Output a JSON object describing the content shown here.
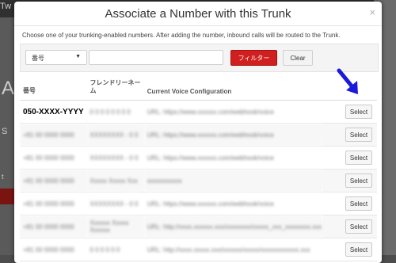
{
  "background": {
    "fragments": [
      "Tw",
      "A",
      "S",
      "t"
    ]
  },
  "modal": {
    "title": "Associate a Number with this Trunk",
    "close_glyph": "×",
    "intro": "Choose one of your trunking-enabled numbers. After adding the number, inbound calls will be routed to the Trunk."
  },
  "filter": {
    "field_label": "番号",
    "search_value": "",
    "filter_button": "フィルター",
    "clear_button": "Clear"
  },
  "table": {
    "headers": {
      "number": "番号",
      "friendly_name": "フレンドリーネーム",
      "voice_config": "Current Voice Configuration"
    },
    "select_label": "Select",
    "rows": [
      {
        "number": "050-XXXX-YYYY",
        "name": "0 0 0 0 0 0 0 0",
        "config": "URL: https://www.xxxxxx.com/webhook/voice"
      },
      {
        "number": "+81 00 0000 0000",
        "name": "XXXXXXXX - 0 0",
        "config": "URL: https://www.xxxxxx.com/webhook/voice"
      },
      {
        "number": "+81 00 0000 0000",
        "name": "XXXXXXXX - 0 0",
        "config": "URL: https://www.xxxxxx.com/webhook/voice"
      },
      {
        "number": "+81 00 0000 0000",
        "name": "Xxxxx Xxxxx Xxx",
        "config": "xxxxxxxxxxx"
      },
      {
        "number": "+81 00 0000 0000",
        "name": "XXXXXXXX - 0 0",
        "config": "URL: https://www.xxxxxx.com/webhook/voice"
      },
      {
        "number": "+81 00 0000 0000",
        "name": "Xxxxxx Xxxxx Xxxxxx",
        "config": "URL: http://xxxx.xxxxxx.xxx/xxxxxxxx/xxxxx_xxx_xxxxxxxx.xxx"
      },
      {
        "number": "+81 00 0000 0000",
        "name": "0 0 0 0 0 0",
        "config": "URL: http://xxxx.xxxxx.xxx/xxxxxx/xxxxx/xxxxxxxxxxxx.xxx"
      }
    ]
  },
  "colors": {
    "primary": "#cf1f1f",
    "arrow": "#1a1adb"
  }
}
